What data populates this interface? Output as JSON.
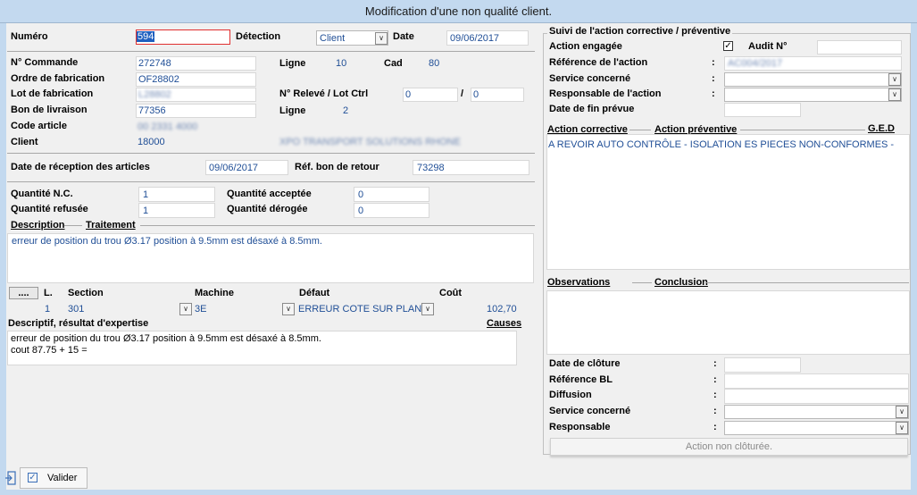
{
  "window": {
    "title": "Modification d'une non qualité client."
  },
  "header": {
    "numero_label": "Numéro",
    "numero_value": "594",
    "detection_label": "Détection",
    "detection_value": "Client",
    "date_label": "Date",
    "date_value": "09/06/2017"
  },
  "order": {
    "commande_label": "N° Commande",
    "commande_value": "272748",
    "ligne1_label": "Ligne",
    "ligne1_value": "10",
    "cad_label": "Cad",
    "cad_value": "80",
    "of_label": "Ordre de fabrication",
    "of_value": "OF28802",
    "lot_label": "Lot de fabrication",
    "lot_value": "L28802",
    "releve_label": "N° Relevé / Lot Ctrl",
    "releve_value1": "0",
    "releve_sep": "/",
    "releve_value2": "0",
    "bl_label": "Bon de livraison",
    "bl_value": "77356",
    "ligne2_label": "Ligne",
    "ligne2_value": "2",
    "article_label": "Code article",
    "article_value": "00 2331 4000",
    "client_label": "Client",
    "client_code": "18000",
    "client_name": "XPO TRANSPORT SOLUTIONS RHONE"
  },
  "reception": {
    "date_label": "Date de réception des articles",
    "date_value": "09/06/2017",
    "ref_label": "Réf. bon de retour",
    "ref_value": "73298"
  },
  "quantities": {
    "nc_label": "Quantité N.C.",
    "nc_value": "1",
    "refusee_label": "Quantité refusée",
    "refusee_value": "1",
    "acceptee_label": "Quantité acceptée",
    "acceptee_value": "0",
    "derogee_label": "Quantité dérogée",
    "derogee_value": "0"
  },
  "description": {
    "tab_description": "Description",
    "tab_traitement": "Traitement",
    "text": "erreur de position du trou Ø3.17 position à 9.5mm est désaxé à 8.5mm."
  },
  "defects": {
    "more_button": "....",
    "col_l": "L.",
    "col_section": "Section",
    "col_machine": "Machine",
    "col_defaut": "Défaut",
    "col_cout": "Coût",
    "row": {
      "l": "1",
      "section": "301",
      "machine": "3E",
      "defaut": "ERREUR COTE SUR PLAN",
      "cout": "102,70"
    },
    "expertise_label": "Descriptif, résultat d'expertise",
    "causes_label": "Causes",
    "expertise_text": "erreur de position du trou Ø3.17 position à 9.5mm est désaxé à 8.5mm.\ncout 87.75 + 15 ="
  },
  "action": {
    "section_title": "Suivi de l'action corrective / préventive",
    "engagee_label": "Action engagée",
    "engagee_checked": true,
    "audit_label": "Audit N°",
    "reference_label": "Référence de l'action",
    "reference_value": "AC004/2017",
    "service_label": "Service concerné",
    "responsable_label": "Responsable de l'action",
    "date_fin_label": "Date de fin prévue",
    "colon": ":",
    "tab_corrective": "Action corrective",
    "tab_preventive": "Action préventive",
    "tab_ged": "G.E.D",
    "corrective_text": "A REVOIR AUTO CONTRÔLE - ISOLATION ES PIECES NON-CONFORMES -",
    "tab_observations": "Observations",
    "tab_conclusion": "Conclusion"
  },
  "closure": {
    "date_label": "Date de clôture",
    "bl_label": "Référence BL",
    "diffusion_label": "Diffusion",
    "service_label": "Service concerné",
    "responsable_label": "Responsable",
    "status_button": "Action non clôturée."
  },
  "footer": {
    "valider_label": "Valider"
  }
}
